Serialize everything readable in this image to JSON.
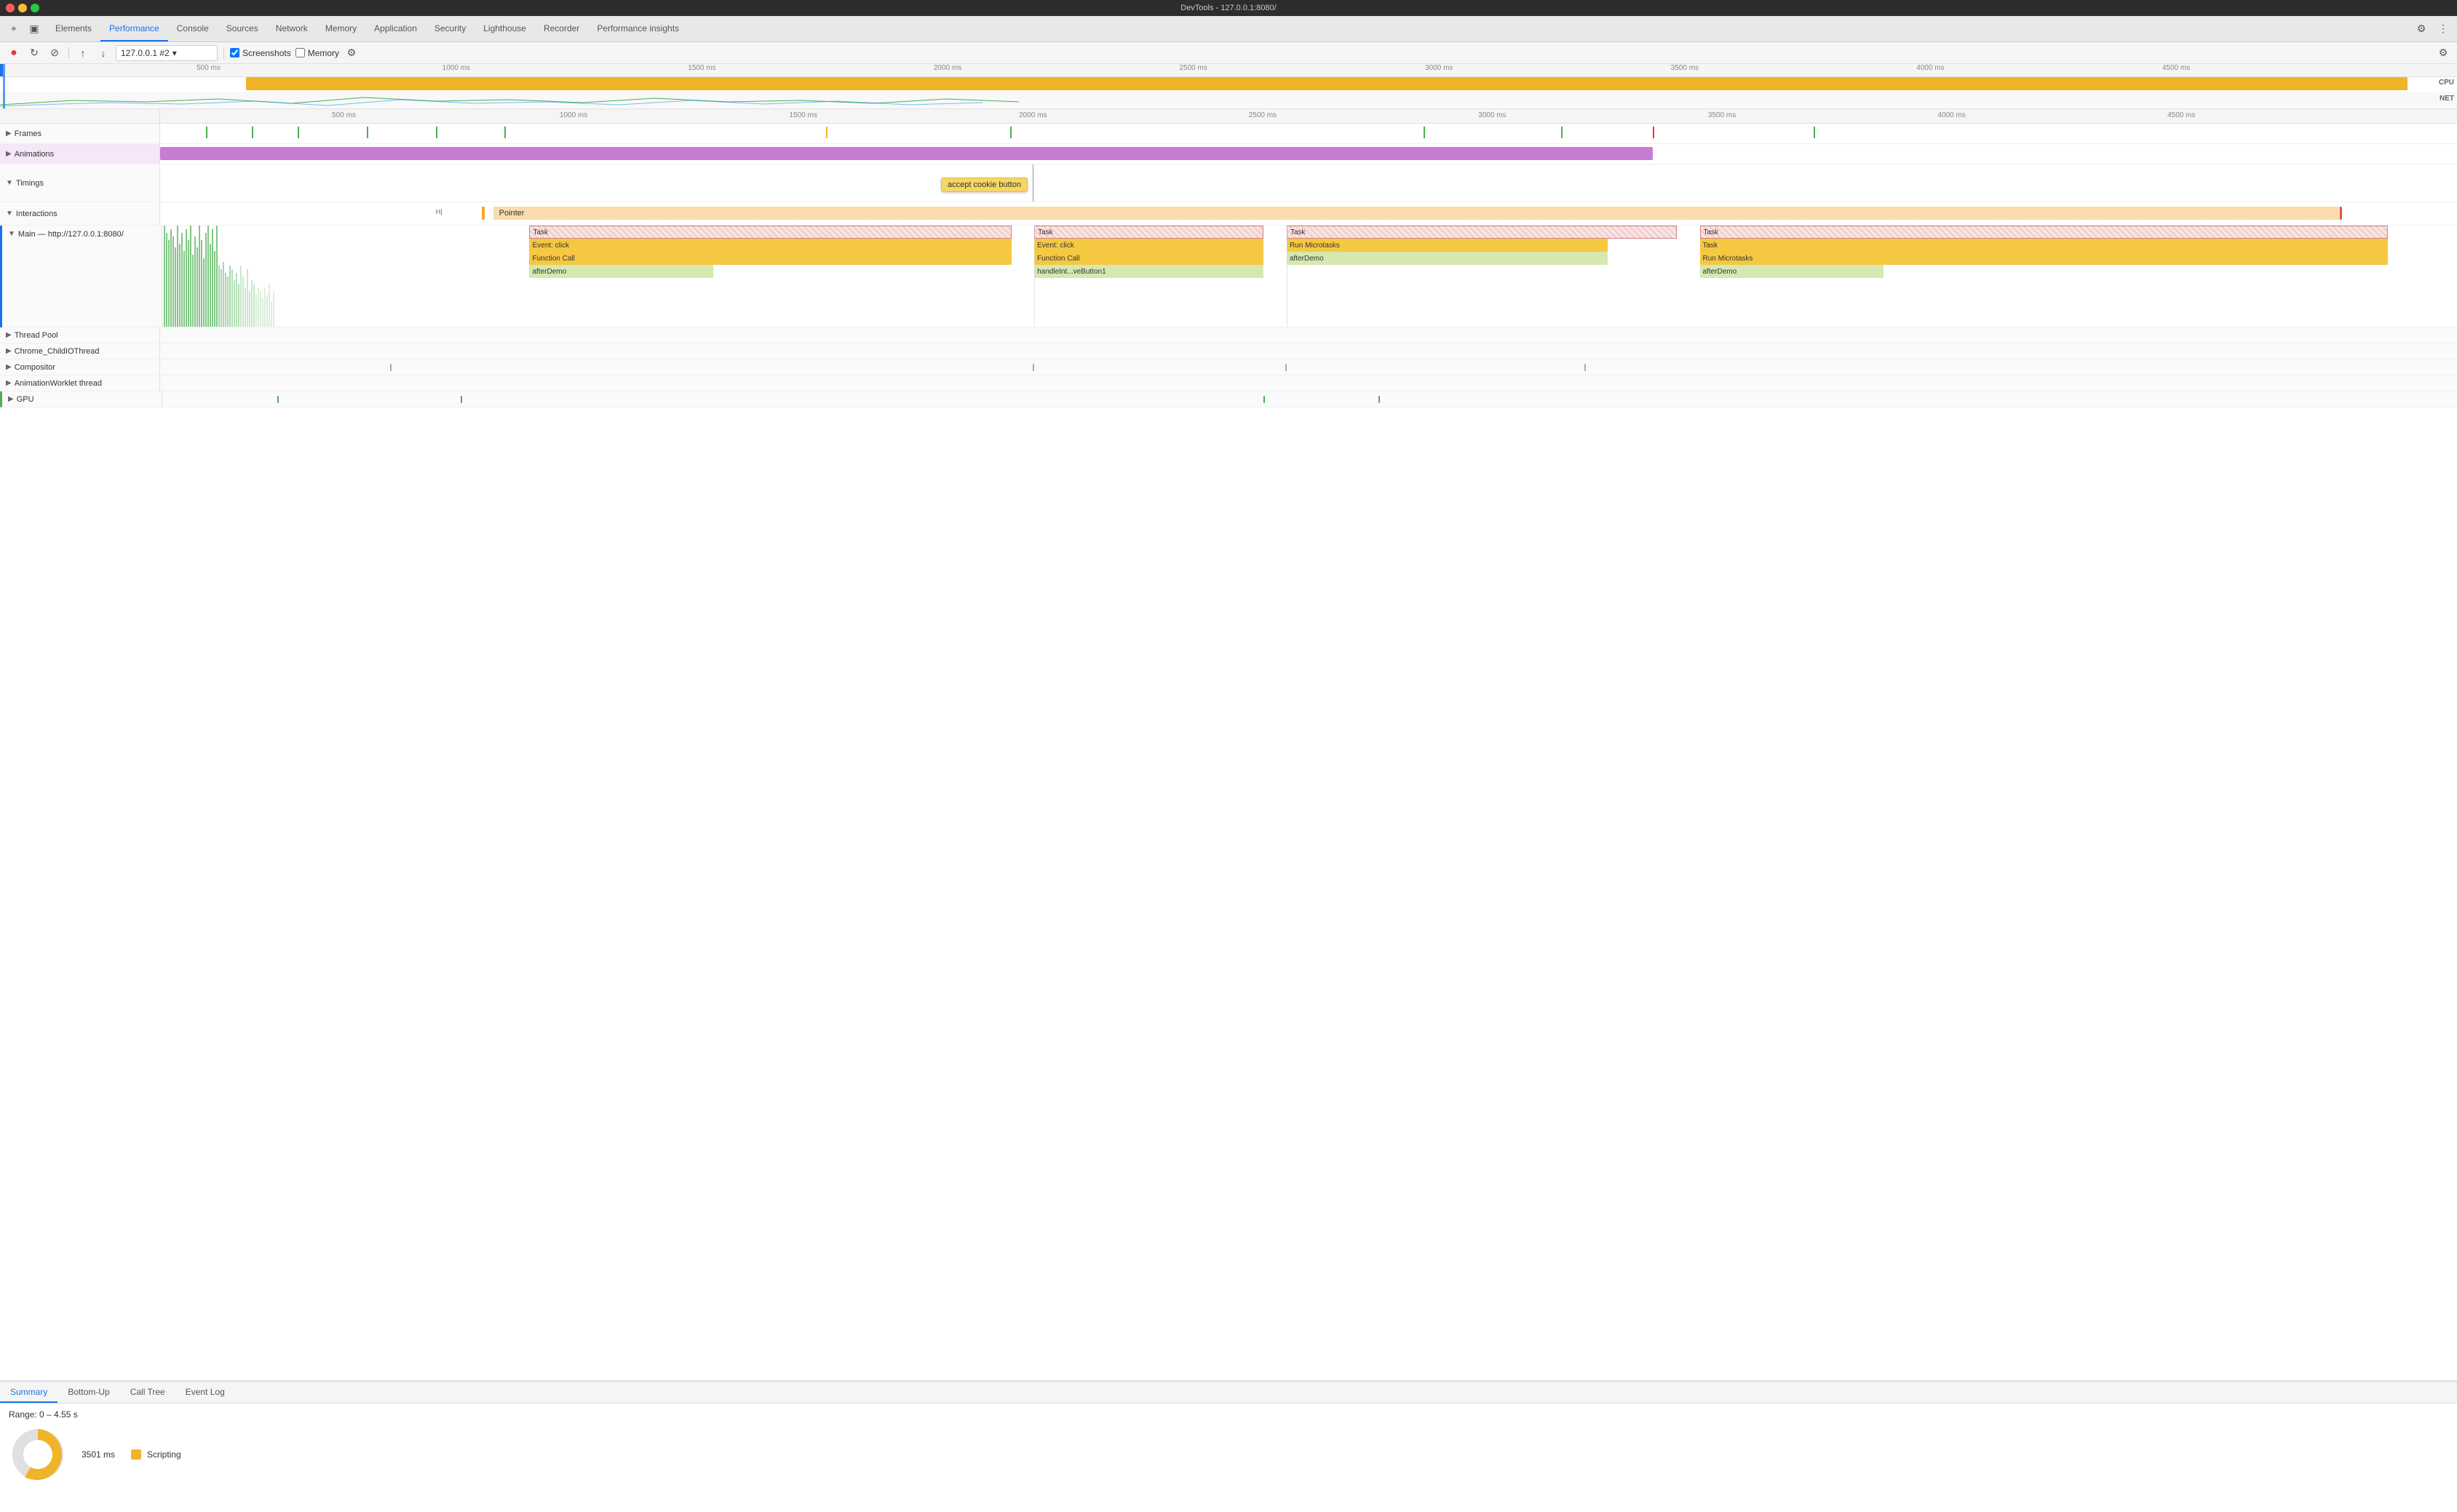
{
  "titlebar": {
    "title": "DevTools - 127.0.0.1:8080/"
  },
  "tabs": {
    "items": [
      "Elements",
      "Performance",
      "Console",
      "Sources",
      "Network",
      "Memory",
      "Application",
      "Security",
      "Lighthouse",
      "Recorder",
      "Performance insights"
    ],
    "active": "Performance"
  },
  "toolbar": {
    "url": "127.0.0.1 #2",
    "screenshots_label": "Screenshots",
    "memory_label": "Memory"
  },
  "overview": {
    "ruler_ticks": [
      "500 ms",
      "1000 ms",
      "1500 ms",
      "2000 ms",
      "2500 ms",
      "3000 ms",
      "3500 ms",
      "4000 ms",
      "4500 ms"
    ],
    "cpu_label": "CPU",
    "net_label": "NET"
  },
  "timeline": {
    "ruler_ticks": [
      "500 ms",
      "1000 ms",
      "1500 ms",
      "2000 ms",
      "2500 ms",
      "3000 ms",
      "3500 ms",
      "4000 ms",
      "4500 ms"
    ],
    "tracks": {
      "frames_label": "Frames",
      "animations_label": "Animations",
      "timings_label": "Timings",
      "timings_tooltip": "accept cookie button",
      "interactions_label": "Interactions",
      "pointer_label": "Pointer",
      "main_label": "Main — http://127.0.0.1:8080/",
      "task_labels": [
        "Task",
        "Task",
        "Task",
        "Task"
      ],
      "event_click_labels": [
        "Event: click",
        "Event: click"
      ],
      "run_microtasks_label": "Run Microtasks",
      "task_inner_label": "Task",
      "function_call_labels": [
        "Function Call",
        "Function Call"
      ],
      "after_demo_labels": [
        "afterDemo",
        "afterDemo",
        "afterDemo"
      ],
      "handle_int_label": "handleInt...veButton1",
      "run_micro2_label": "Run Microtasks",
      "thread_pool_label": "Thread Pool",
      "chrome_child_label": "Chrome_ChildIOThread",
      "compositor_label": "Compositor",
      "animation_worklet_label": "AnimationWorklet thread",
      "gpu_label": "GPU"
    }
  },
  "bottom_panel": {
    "tabs": [
      "Summary",
      "Bottom-Up",
      "Call Tree",
      "Event Log"
    ],
    "active_tab": "Summary",
    "range_label": "Range: 0 – 4.55 s",
    "scripting_ms": "3501 ms",
    "scripting_label": "Scripting"
  },
  "icons": {
    "cursor": "⌖",
    "layers": "▣",
    "record": "●",
    "reload": "↻",
    "clear": "⊘",
    "upload": "↑",
    "download": "↓",
    "screenshot": "📷",
    "gear": "⚙",
    "dots": "⋮",
    "collapse": "▶",
    "expand": "▼",
    "chevron_down": "▾"
  }
}
